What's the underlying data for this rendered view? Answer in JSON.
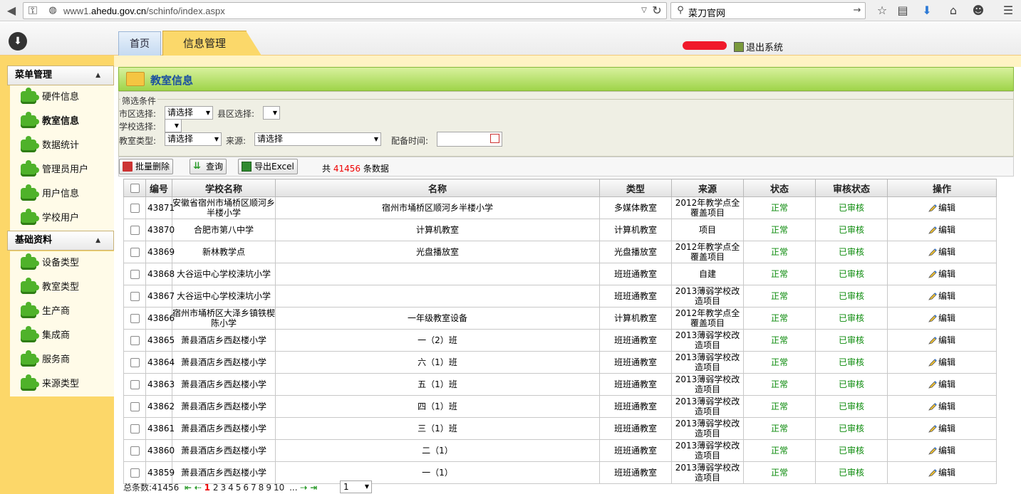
{
  "browser": {
    "url_prefix": "www1.",
    "url_domain": "ahedu.gov.cn",
    "url_path": "/schinfo/index.aspx",
    "search_text": "菜刀官网"
  },
  "header": {
    "tabs": [
      {
        "label": "首页"
      },
      {
        "label": "信息管理"
      }
    ],
    "logout_label": "退出系统"
  },
  "sidebar": {
    "sections": [
      {
        "title": "菜单管理",
        "items": [
          "硬件信息",
          "教室信息",
          "数据统计",
          "管理员用户",
          "用户信息",
          "学校用户"
        ]
      },
      {
        "title": "基础资料",
        "items": [
          "设备类型",
          "教室类型",
          "生产商",
          "集成商",
          "服务商",
          "来源类型"
        ]
      }
    ],
    "active_item": "教室信息"
  },
  "main": {
    "title": "教室信息",
    "filter": {
      "legend": "筛选条件",
      "city_label": "市区选择:",
      "city_value": "请选择",
      "county_label": "县区选择:",
      "county_value": "",
      "school_label": "学校选择:",
      "school_value": "",
      "type_label": "教室类型:",
      "type_value": "请选择",
      "source_label": "来源:",
      "source_value": "请选择",
      "date_label": "配备时间:",
      "date_value": ""
    },
    "toolbar": {
      "batch_delete": "批量删除",
      "query": "查询",
      "export": "导出Excel",
      "count_prefix": "共",
      "count_value": "41456",
      "count_suffix": "条数据"
    },
    "table": {
      "headers": [
        "",
        "编号",
        "学校名称",
        "名称",
        "类型",
        "来源",
        "状态",
        "审核状态",
        "操作"
      ],
      "edit_label": "编辑",
      "rows": [
        {
          "id": "43871",
          "school": "安徽省宿州市埇桥区顺河乡半楼小学",
          "name": "宿州市埇桥区顺河乡半楼小学",
          "type": "多媒体教室",
          "source": "2012年教学点全覆盖项目",
          "status": "正常",
          "audit": "已审核"
        },
        {
          "id": "43870",
          "school": "合肥市第八中学",
          "name": "计算机教室",
          "type": "计算机教室",
          "source": "项目",
          "status": "正常",
          "audit": "已审核"
        },
        {
          "id": "43869",
          "school": "新林教学点",
          "name": "光盘播放室",
          "type": "光盘播放室",
          "source": "2012年教学点全覆盖项目",
          "status": "正常",
          "audit": "已审核"
        },
        {
          "id": "43868",
          "school": "大谷运中心学校涑坑小学",
          "name": "",
          "type": "班班通教室",
          "source": "自建",
          "status": "正常",
          "audit": "已审核"
        },
        {
          "id": "43867",
          "school": "大谷运中心学校涑坑小学",
          "name": "",
          "type": "班班通教室",
          "source": "2013薄弱学校改造项目",
          "status": "正常",
          "audit": "已审核"
        },
        {
          "id": "43866",
          "school": "宿州市埇桥区大泽乡镇铁楔陈小学",
          "name": "一年级教室设备",
          "type": "计算机教室",
          "source": "2012年教学点全覆盖项目",
          "status": "正常",
          "audit": "已审核"
        },
        {
          "id": "43865",
          "school": "萧县酒店乡西赵楼小学",
          "name": "一（2）班",
          "type": "班班通教室",
          "source": "2013薄弱学校改造项目",
          "status": "正常",
          "audit": "已审核"
        },
        {
          "id": "43864",
          "school": "萧县酒店乡西赵楼小学",
          "name": "六（1）班",
          "type": "班班通教室",
          "source": "2013薄弱学校改造项目",
          "status": "正常",
          "audit": "已审核"
        },
        {
          "id": "43863",
          "school": "萧县酒店乡西赵楼小学",
          "name": "五（1）班",
          "type": "班班通教室",
          "source": "2013薄弱学校改造项目",
          "status": "正常",
          "audit": "已审核"
        },
        {
          "id": "43862",
          "school": "萧县酒店乡西赵楼小学",
          "name": "四（1）班",
          "type": "班班通教室",
          "source": "2013薄弱学校改造项目",
          "status": "正常",
          "audit": "已审核"
        },
        {
          "id": "43861",
          "school": "萧县酒店乡西赵楼小学",
          "name": "三（1）班",
          "type": "班班通教室",
          "source": "2013薄弱学校改造项目",
          "status": "正常",
          "audit": "已审核"
        },
        {
          "id": "43860",
          "school": "萧县酒店乡西赵楼小学",
          "name": "二（1）",
          "type": "班班通教室",
          "source": "2013薄弱学校改造项目",
          "status": "正常",
          "audit": "已审核"
        },
        {
          "id": "43859",
          "school": "萧县酒店乡西赵楼小学",
          "name": "一（1）",
          "type": "班班通教室",
          "source": "2013薄弱学校改造项目",
          "status": "正常",
          "audit": "已审核"
        }
      ]
    },
    "pager": {
      "total_label": "总条数:41456",
      "current_page": "1",
      "pages": [
        "2",
        "3",
        "4",
        "5",
        "6",
        "7",
        "8",
        "9",
        "10"
      ],
      "ellipsis": "...",
      "page_select_value": "1"
    }
  },
  "colors": {
    "sidebar_bg": "#fcd769",
    "title_bar": "#9fd44a",
    "ok_green": "#0a8a0a",
    "accent_red": "#ee0000"
  }
}
